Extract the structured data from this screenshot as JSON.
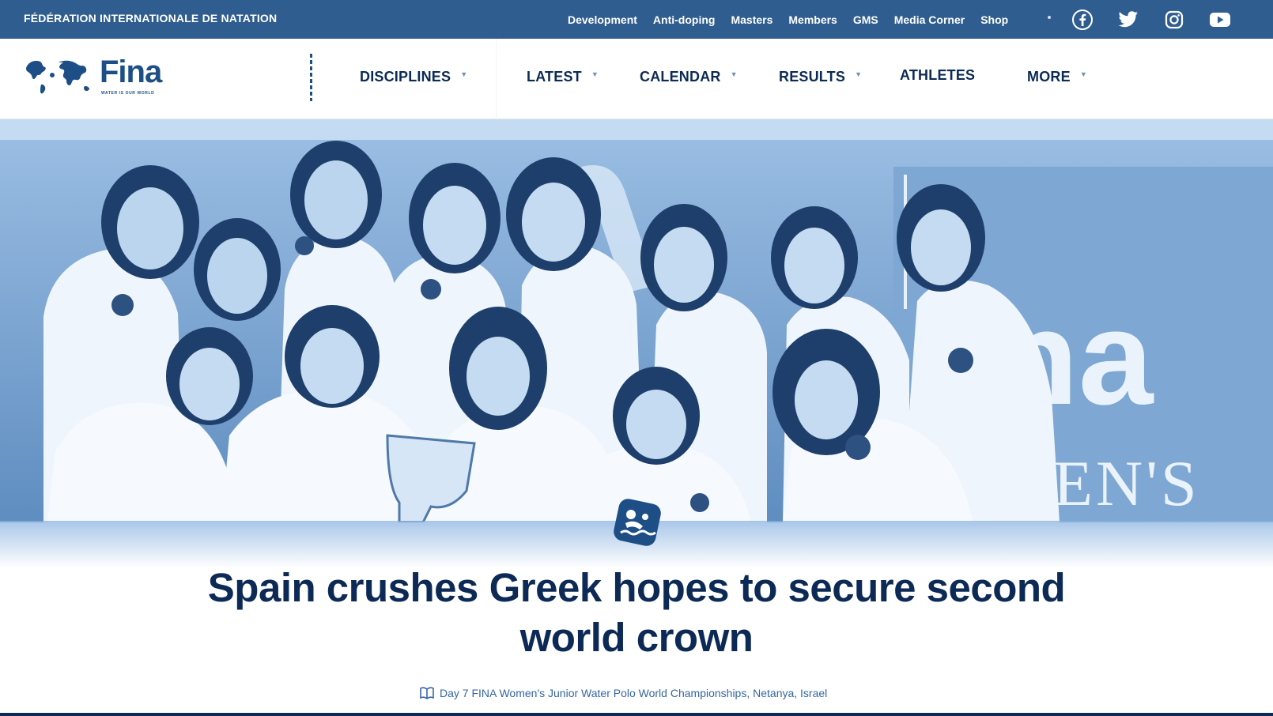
{
  "topbar": {
    "org_name": "FÉDÉRATION INTERNATIONALE DE NATATION",
    "links": [
      "Development",
      "Anti-doping",
      "Masters",
      "Members",
      "GMS",
      "Media Corner",
      "Shop"
    ],
    "social_icons": [
      "facebook-icon",
      "twitter-icon",
      "instagram-icon",
      "youtube-icon"
    ],
    "background_color": "#2f5d8f"
  },
  "logo": {
    "wordmark": "Fina",
    "tagline": "WATER IS OUR WORLD"
  },
  "nav": {
    "items": [
      {
        "label": "DISCIPLINES",
        "dropdown": true
      },
      {
        "label": "LATEST",
        "dropdown": true
      },
      {
        "label": "CALENDAR",
        "dropdown": true
      },
      {
        "label": "RESULTS",
        "dropdown": true
      },
      {
        "label": "ATHLETES",
        "dropdown": false
      },
      {
        "label": "MORE",
        "dropdown": true
      }
    ]
  },
  "hero": {
    "banner_text": "MEN'S",
    "banner_brand": "na",
    "sport_badge_icon": "water-polo-icon"
  },
  "article": {
    "headline": "Spain crushes Greek hopes to secure second world crown",
    "caption_icon": "book-icon",
    "caption": "Day 7 FINA Women's Junior Water Polo World Championships, Netanya, Israel"
  },
  "colors": {
    "navy": "#0c2a55",
    "brand_blue": "#1d4f86",
    "hero_tint": "#6f9ac8"
  }
}
